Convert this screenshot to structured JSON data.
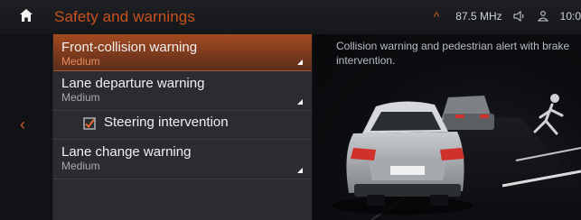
{
  "header": {
    "title": "Safety and warnings",
    "home_icon": "home-icon",
    "status": {
      "radio": "87.5 MHz",
      "clock_partial": "10:0"
    }
  },
  "nav": {
    "back_icon": "chevron-left-icon"
  },
  "menu": {
    "items": [
      {
        "label": "Front-collision warning",
        "value": "Medium",
        "selected": true
      },
      {
        "label": "Lane departure warning",
        "value": "Medium"
      }
    ],
    "checkbox": {
      "label": "Steering intervention",
      "checked": true
    },
    "items2": [
      {
        "label": "Lane change warning",
        "value": "Medium"
      }
    ]
  },
  "description": "Collision warning and pedestrian alert with brake intervention.",
  "colors": {
    "accent": "#c8531f",
    "selected_top": "#a34a20",
    "selected_bottom": "#5a2d1b"
  }
}
